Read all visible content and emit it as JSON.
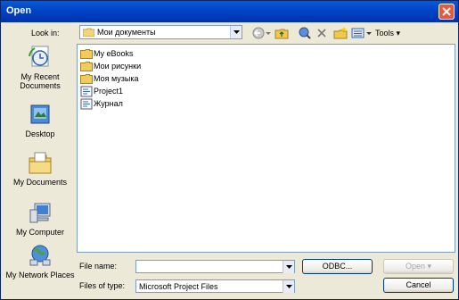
{
  "window": {
    "title": "Open"
  },
  "lookin": {
    "label": "Look in:",
    "value": "Мои документы"
  },
  "toolbar": {
    "icons": [
      "back-icon",
      "up-folder-icon",
      "search-web-icon",
      "delete-icon",
      "new-folder-icon",
      "views-icon"
    ],
    "tools_label": "Tools"
  },
  "places": [
    {
      "icon": "recent-documents-icon",
      "label": "My Recent Documents"
    },
    {
      "icon": "desktop-icon",
      "label": "Desktop"
    },
    {
      "icon": "my-documents-icon",
      "label": "My Documents"
    },
    {
      "icon": "my-computer-icon",
      "label": "My Computer"
    },
    {
      "icon": "my-network-places-icon",
      "label": "My Network Places"
    }
  ],
  "files": [
    {
      "icon": "folder-icon",
      "name": "My eBooks"
    },
    {
      "icon": "folder-icon",
      "name": "Мои рисунки"
    },
    {
      "icon": "folder-icon",
      "name": "Моя музыка"
    },
    {
      "icon": "project-file-icon",
      "name": "Project1"
    },
    {
      "icon": "project-file-icon",
      "name": "Журнал"
    }
  ],
  "filename": {
    "label": "File name:",
    "value": ""
  },
  "filetype": {
    "label": "Files of type:",
    "value": "Microsoft Project Files"
  },
  "buttons": {
    "odbc": "ODBC...",
    "open": "Open",
    "cancel": "Cancel"
  },
  "colors": {
    "titlebar": "#0046c8",
    "dialog_bg": "#ece9d8",
    "close": "#e35a3e"
  }
}
